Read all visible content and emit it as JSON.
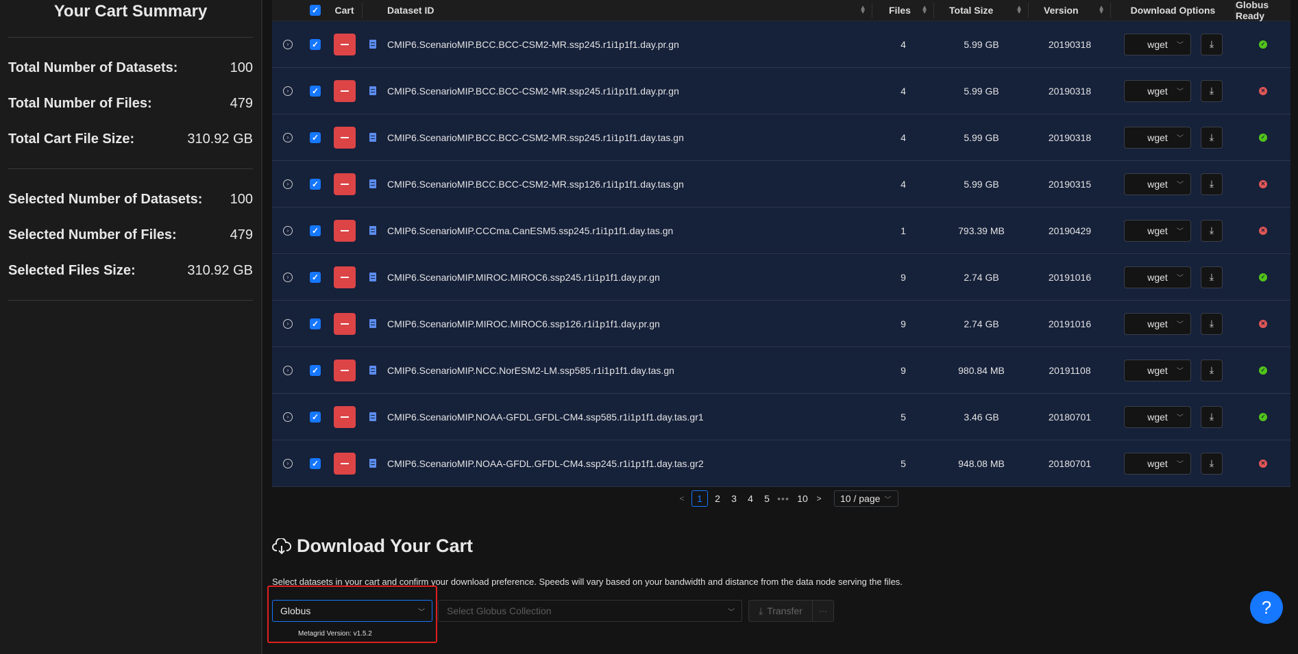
{
  "sidebar": {
    "title": "Your Cart Summary",
    "totals": [
      {
        "label": "Total Number of Datasets:",
        "value": "100"
      },
      {
        "label": "Total Number of Files:",
        "value": "479"
      },
      {
        "label": "Total Cart File Size:",
        "value": "310.92 GB"
      }
    ],
    "selected": [
      {
        "label": "Selected Number of Datasets:",
        "value": "100"
      },
      {
        "label": "Selected Number of Files:",
        "value": "479"
      },
      {
        "label": "Selected Files Size:",
        "value": "310.92 GB"
      }
    ]
  },
  "table": {
    "headers": {
      "cart": "Cart",
      "dataset_id": "Dataset ID",
      "files": "Files",
      "total_size": "Total Size",
      "version": "Version",
      "download_options": "Download Options",
      "globus_ready": "Globus Ready"
    },
    "rows": [
      {
        "id": "CMIP6.ScenarioMIP.BCC.BCC-CSM2-MR.ssp245.r1i1p1f1.day.pr.gn",
        "files": "4",
        "size": "5.99 GB",
        "version": "20190318",
        "download": "wget",
        "globus_ready": true
      },
      {
        "id": "CMIP6.ScenarioMIP.BCC.BCC-CSM2-MR.ssp245.r1i1p1f1.day.pr.gn",
        "files": "4",
        "size": "5.99 GB",
        "version": "20190318",
        "download": "wget",
        "globus_ready": false
      },
      {
        "id": "CMIP6.ScenarioMIP.BCC.BCC-CSM2-MR.ssp245.r1i1p1f1.day.tas.gn",
        "files": "4",
        "size": "5.99 GB",
        "version": "20190318",
        "download": "wget",
        "globus_ready": true
      },
      {
        "id": "CMIP6.ScenarioMIP.BCC.BCC-CSM2-MR.ssp126.r1i1p1f1.day.tas.gn",
        "files": "4",
        "size": "5.99 GB",
        "version": "20190315",
        "download": "wget",
        "globus_ready": false
      },
      {
        "id": "CMIP6.ScenarioMIP.CCCma.CanESM5.ssp245.r1i1p1f1.day.tas.gn",
        "files": "1",
        "size": "793.39 MB",
        "version": "20190429",
        "download": "wget",
        "globus_ready": false
      },
      {
        "id": "CMIP6.ScenarioMIP.MIROC.MIROC6.ssp245.r1i1p1f1.day.pr.gn",
        "files": "9",
        "size": "2.74 GB",
        "version": "20191016",
        "download": "wget",
        "globus_ready": true
      },
      {
        "id": "CMIP6.ScenarioMIP.MIROC.MIROC6.ssp126.r1i1p1f1.day.pr.gn",
        "files": "9",
        "size": "2.74 GB",
        "version": "20191016",
        "download": "wget",
        "globus_ready": false
      },
      {
        "id": "CMIP6.ScenarioMIP.NCC.NorESM2-LM.ssp585.r1i1p1f1.day.tas.gn",
        "files": "9",
        "size": "980.84 MB",
        "version": "20191108",
        "download": "wget",
        "globus_ready": true
      },
      {
        "id": "CMIP6.ScenarioMIP.NOAA-GFDL.GFDL-CM4.ssp585.r1i1p1f1.day.tas.gr1",
        "files": "5",
        "size": "3.46 GB",
        "version": "20180701",
        "download": "wget",
        "globus_ready": true
      },
      {
        "id": "CMIP6.ScenarioMIP.NOAA-GFDL.GFDL-CM4.ssp245.r1i1p1f1.day.tas.gr2",
        "files": "5",
        "size": "948.08 MB",
        "version": "20180701",
        "download": "wget",
        "globus_ready": false
      }
    ]
  },
  "pagination": {
    "pages": [
      "1",
      "2",
      "3",
      "4",
      "5"
    ],
    "current": "1",
    "ellipsis": "•••",
    "last": "10",
    "page_size": "10 / page"
  },
  "download": {
    "title": "Download Your Cart",
    "description": "Select datasets in your cart and confirm your download preference. Speeds will vary based on your bandwidth and distance from the data node serving the files.",
    "method_value": "Globus",
    "collection_placeholder": "Select Globus Collection",
    "transfer_label": "Transfer",
    "more_label": "···"
  },
  "version_text": "Metagrid Version: v1.5.2",
  "help_label": "?",
  "colors": {
    "accent": "#1677ff",
    "remove": "#dc4446",
    "globus_ok": "#52c41a",
    "globus_no": "#e05656",
    "row_bg": "#16213a",
    "highlight": "#e02020"
  }
}
